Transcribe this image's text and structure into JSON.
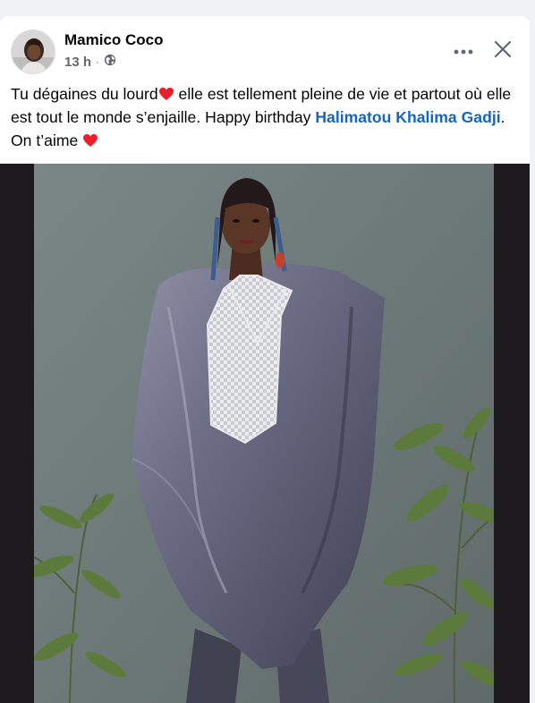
{
  "post": {
    "author": "Mamico Coco",
    "time": "13 h",
    "separator": "·",
    "text_part1": "Tu dégaines du lourd",
    "text_part2": " elle est tellement pleine de vie et partout où elle est tout le monde s’enjaille. Happy birthday ",
    "mention": "Halimatou Khalima Gadji",
    "text_part3": ". On t’aime "
  },
  "icons": {
    "privacy": "globe-icon",
    "more": "more-horizontal-icon",
    "close": "close-icon",
    "emoji": "red-heart-icon"
  },
  "colors": {
    "mention": "#1565c0",
    "heart": "#e8202a",
    "secondary_text": "#65676b",
    "photo_background": "#6f7c7b"
  }
}
